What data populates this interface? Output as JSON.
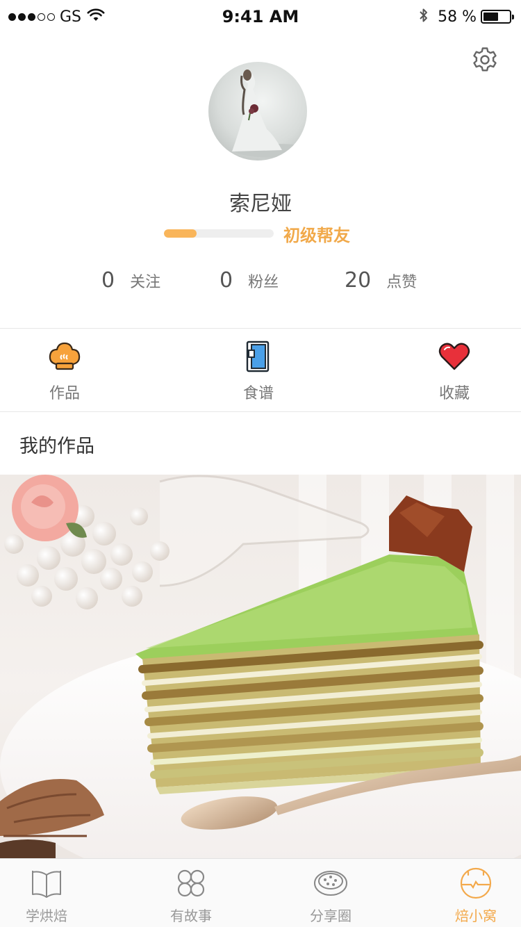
{
  "status_bar": {
    "carrier": "GS",
    "time": "9:41 AM",
    "battery": "58 %",
    "battery_level": 0.58
  },
  "profile": {
    "name": "索尼娅",
    "level": {
      "title": "初级帮友",
      "progress": 0.3
    },
    "stats": [
      {
        "value": "0",
        "label": "关注"
      },
      {
        "value": "0",
        "label": "粉丝"
      },
      {
        "value": "20",
        "label": "点赞"
      }
    ]
  },
  "features": [
    {
      "label": "作品",
      "icon": "chef-hat-icon",
      "color": "#f7a23b"
    },
    {
      "label": "食谱",
      "icon": "recipe-book-icon",
      "color": "#3a8fd6"
    },
    {
      "label": "收藏",
      "icon": "heart-icon",
      "color": "#e8303a"
    }
  ],
  "section": {
    "title": "我的作品"
  },
  "tabs": [
    {
      "label": "学烘焙",
      "icon": "book-icon",
      "active": false
    },
    {
      "label": "有故事",
      "icon": "clover-icon",
      "active": false
    },
    {
      "label": "分享圈",
      "icon": "cookie-icon",
      "active": false
    },
    {
      "label": "焙小窝",
      "icon": "cake-icon",
      "active": true
    }
  ],
  "colors": {
    "accent": "#f3a94b",
    "text": "#333333",
    "muted": "#777777",
    "divider": "#e6e6e6"
  }
}
